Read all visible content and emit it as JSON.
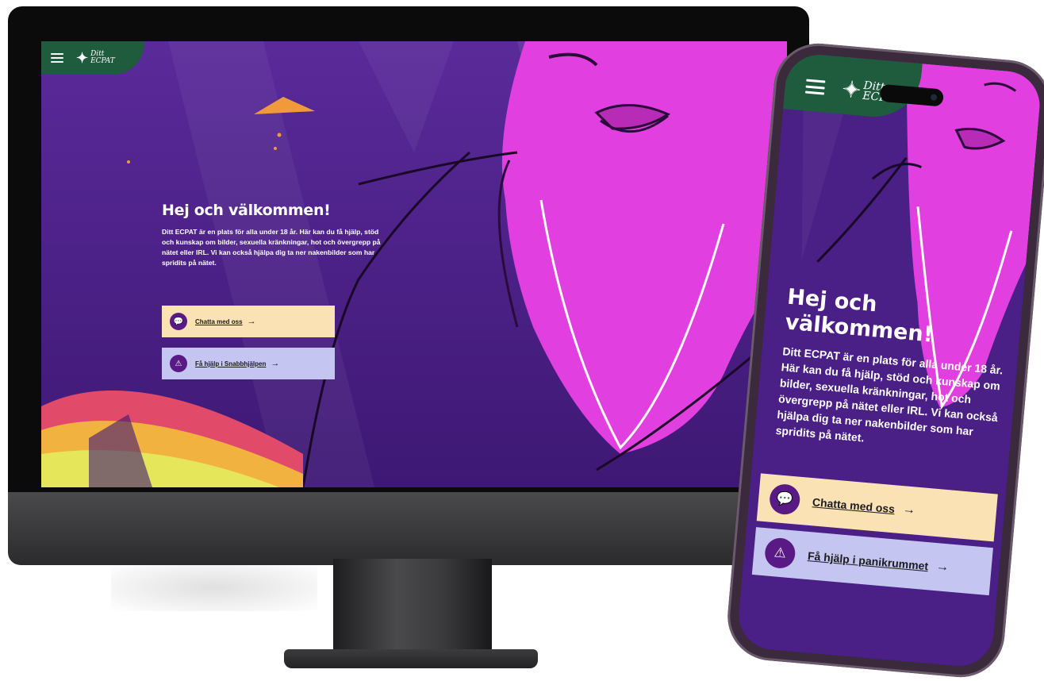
{
  "brand": {
    "logo_text_line1": "Ditt",
    "logo_text_line2": "ECPAT",
    "logo_figure": "✦",
    "green": "#1f5c3e",
    "purple": "#4a1f86",
    "magenta": "#e23fe0"
  },
  "desktop": {
    "title": "Hej och välkommen!",
    "intro": "Ditt ECPAT är en plats för alla under 18 år. Här kan du få hjälp, stöd och kunskap om bilder, sexuella kränkningar, hot och övergrepp på nätet eller IRL. Vi kan också hjälpa dig ta ner nakenbilder som har spridits på nätet.",
    "chat_label": "Chatta med oss",
    "help_label": "Få hjälp i Snabbhjälpen",
    "arrow": "→"
  },
  "mobile": {
    "title": "Hej och välkommen!",
    "intro": "Ditt ECPAT är en plats för alla under 18 år. Här kan du få hjälp, stöd och kunskap om bilder, sexuella kränkningar, hot och övergrepp på nätet eller IRL. Vi kan också hjälpa dig ta ner nakenbilder som har spridits på nätet.",
    "chat_label": "Chatta med oss",
    "help_label": "Få hjälp i panikrummet",
    "arrow": "→"
  },
  "icons": {
    "menu": "menu-icon",
    "chat": "chat-bubble-icon",
    "warning": "warning-icon",
    "chat_glyph": "💬",
    "warning_glyph": "⚠"
  }
}
